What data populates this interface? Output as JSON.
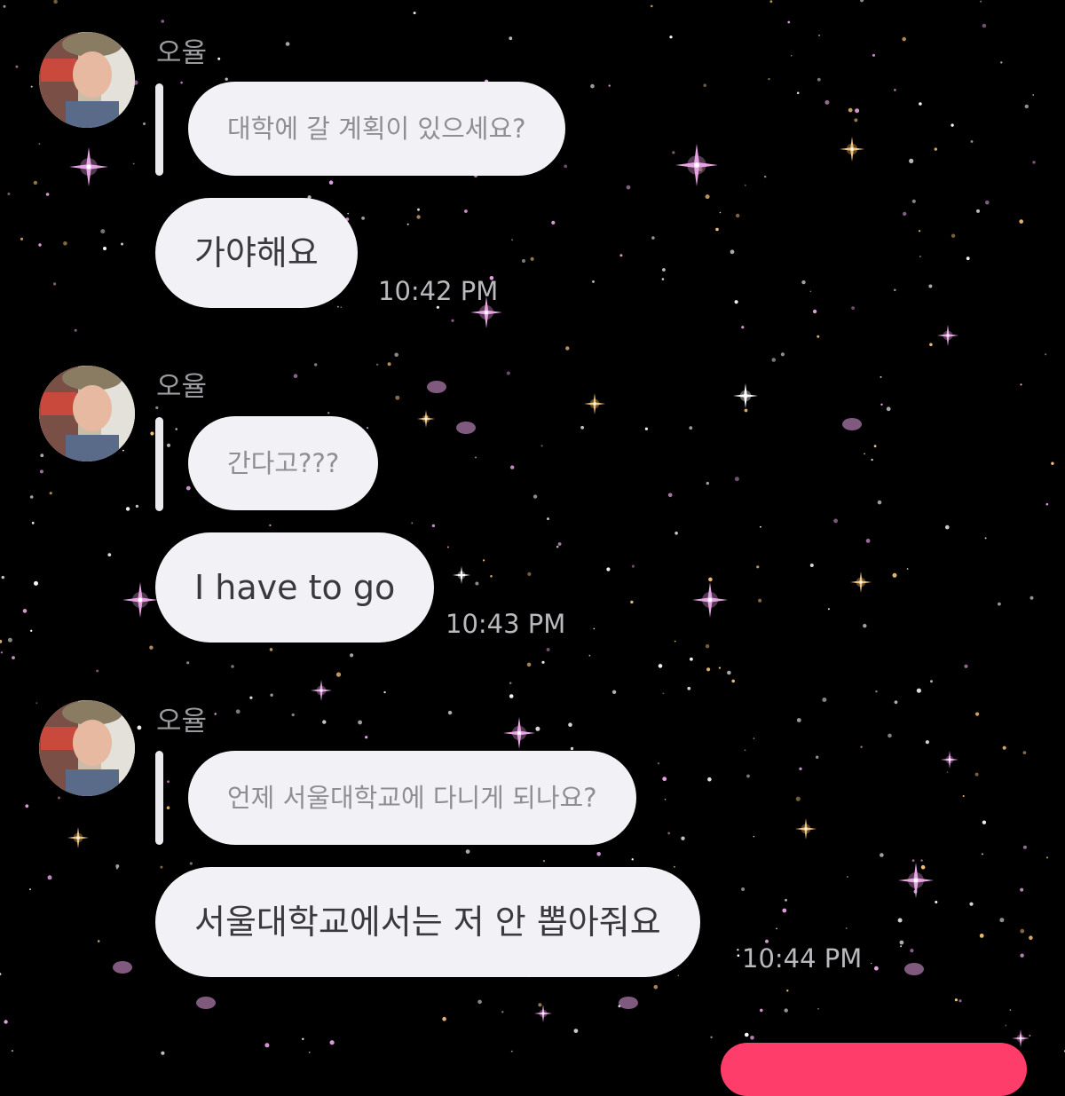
{
  "colors": {
    "background": "#000000",
    "bubble": "#f2f2f6",
    "quote_text": "#8e8e93",
    "message_text": "#3a3a3c",
    "timestamp": "#b9b9be",
    "outgoing_bubble": "#ff3d6a",
    "star_pink": "#e9a4e6",
    "star_gold": "#f2c27a"
  },
  "conversation": {
    "messages": [
      {
        "sender": "오율",
        "quoted": "대학에 갈 계획이 있으세요?",
        "text": "가야해요",
        "time": "10:42 PM"
      },
      {
        "sender": "오율",
        "quoted": "간다고???",
        "text": "I have to go",
        "time": "10:43 PM"
      },
      {
        "sender": "오율",
        "quoted": "언제 서울대학교에 다니게 되나요?",
        "text": "서울대학교에서는 저 안 뽑아줘요",
        "time": "10:44 PM"
      }
    ]
  }
}
